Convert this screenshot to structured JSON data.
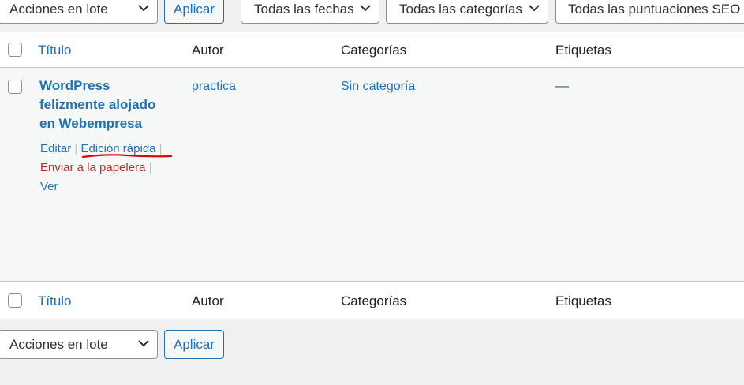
{
  "top_nav": {
    "bulk_actions": "Acciones en lote",
    "apply": "Aplicar",
    "dates_filter": "Todas las fechas",
    "categories_filter": "Todas las categorías",
    "seo_filter": "Todas las puntuaciones SEO"
  },
  "columns": {
    "title": "Título",
    "author": "Autor",
    "categories": "Categorías",
    "tags": "Etiquetas"
  },
  "post": {
    "title_line1": "WordPress",
    "title_line2": "felizmente alojado",
    "title_line3": "en Webempresa",
    "author": "practica",
    "category": "Sin categoría",
    "tags": "—",
    "actions": {
      "edit": "Editar",
      "quick_edit": "Edición rápida",
      "trash": "Enviar a la papelera",
      "view": "Ver",
      "separator": "|"
    }
  },
  "bottom_nav": {
    "bulk_actions": "Acciones en lote",
    "apply": "Aplicar"
  },
  "colors": {
    "link": "#2271b1",
    "trash": "#b32d2e",
    "annotation": "#e00000"
  }
}
